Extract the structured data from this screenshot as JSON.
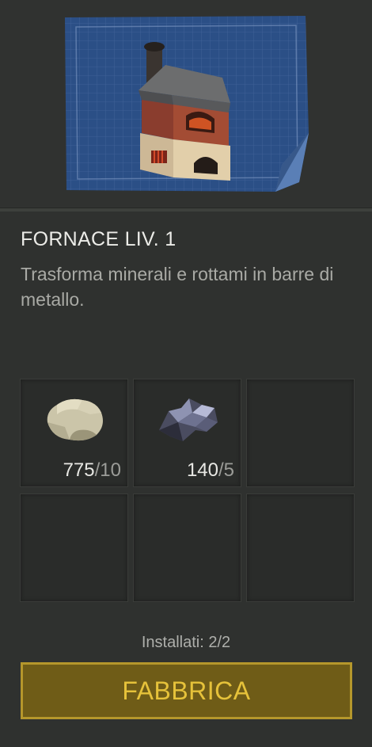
{
  "building": {
    "title": "FORNACE LIV. 1",
    "description": "Trasforma minerali e rottami in barre di metallo."
  },
  "slots": [
    {
      "icon": "stone-icon",
      "have": "775",
      "need": "/10"
    },
    {
      "icon": "scrap-metal-icon",
      "have": "140",
      "need": "/5"
    },
    {
      "icon": "",
      "have": "",
      "need": ""
    },
    {
      "icon": "",
      "have": "",
      "need": ""
    },
    {
      "icon": "",
      "have": "",
      "need": ""
    },
    {
      "icon": "",
      "have": "",
      "need": ""
    }
  ],
  "installed_label": "Installati: 2/2",
  "craft_button": "FABBRICA",
  "colors": {
    "background": "#2f312f",
    "button_fill": "#6f5c17",
    "button_border": "#b5972b",
    "button_text": "#e6c23a",
    "blueprint": "#2b4f86"
  }
}
